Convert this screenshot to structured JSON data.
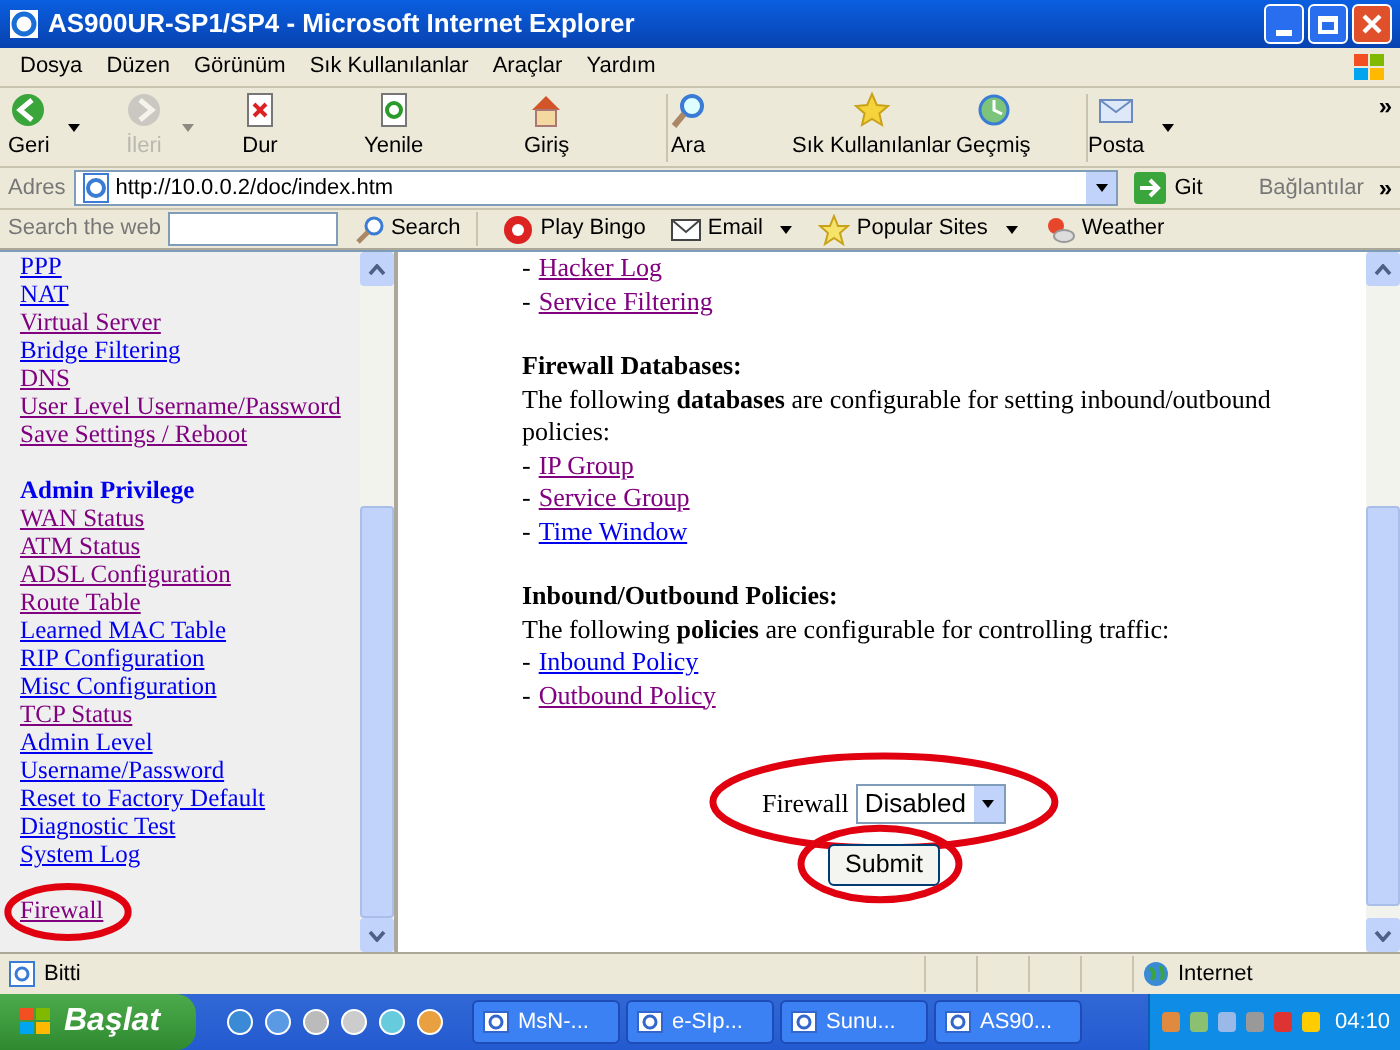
{
  "window": {
    "title": "AS900UR-SP1/SP4 - Microsoft Internet Explorer"
  },
  "menu": [
    "Dosya",
    "Düzen",
    "Görünüm",
    "Sık Kullanılanlar",
    "Araçlar",
    "Yardım"
  ],
  "toolbar": [
    {
      "label": "Geri",
      "disabled": false,
      "dropdown": true
    },
    {
      "label": "İleri",
      "disabled": true,
      "dropdown": true
    },
    {
      "label": "Dur",
      "disabled": false,
      "dropdown": false
    },
    {
      "label": "Yenile",
      "disabled": false,
      "dropdown": false
    },
    {
      "label": "Giriş",
      "disabled": false,
      "dropdown": false
    },
    {
      "label": "Ara",
      "disabled": false,
      "dropdown": false
    },
    {
      "label": "Sık Kullanılanlar",
      "disabled": false,
      "dropdown": false
    },
    {
      "label": "Geçmiş",
      "disabled": false,
      "dropdown": false
    },
    {
      "label": "Posta",
      "disabled": false,
      "dropdown": true
    }
  ],
  "toolbar_more": "»",
  "address": {
    "label": "Adres",
    "value": "http://10.0.0.2/doc/index.htm",
    "go": "Git",
    "links": "Bağlantılar",
    "more": "»"
  },
  "search_bar": {
    "label": "Search the web",
    "button": "Search",
    "items": [
      {
        "label": "Play Bingo",
        "dropdown": false
      },
      {
        "label": "Email",
        "dropdown": true
      },
      {
        "label": "Popular Sites",
        "dropdown": true
      },
      {
        "label": "Weather",
        "dropdown": false
      }
    ]
  },
  "sidebar": {
    "sections": [
      {
        "links": [
          {
            "label": "PPP",
            "visited": false,
            "circled": false
          },
          {
            "label": "NAT",
            "visited": false,
            "circled": false
          },
          {
            "label": "Virtual Server",
            "visited": true,
            "circled": false
          },
          {
            "label": "Bridge Filtering",
            "visited": false,
            "circled": false
          },
          {
            "label": "DNS",
            "visited": true,
            "circled": false
          },
          {
            "label": "User Level Username/Password",
            "visited": true,
            "circled": false
          },
          {
            "label": "Save Settings / Reboot",
            "visited": true,
            "circled": false
          }
        ]
      },
      {
        "heading": "Admin Privilege",
        "links": [
          {
            "label": "WAN Status",
            "visited": true,
            "circled": false
          },
          {
            "label": "ATM Status",
            "visited": true,
            "circled": false
          },
          {
            "label": "ADSL Configuration",
            "visited": true,
            "circled": false
          },
          {
            "label": "Route Table",
            "visited": true,
            "circled": false
          },
          {
            "label": "Learned MAC Table",
            "visited": false,
            "circled": false
          },
          {
            "label": "RIP Configuration",
            "visited": false,
            "circled": false
          },
          {
            "label": "Misc Configuration",
            "visited": false,
            "circled": false
          },
          {
            "label": "TCP Status",
            "visited": true,
            "circled": false
          },
          {
            "label": "Admin Level",
            "visited": false,
            "circled": false
          },
          {
            "label": "Username/Password",
            "visited": false,
            "circled": false
          },
          {
            "label": "Reset to Factory Default",
            "visited": false,
            "circled": false
          },
          {
            "label": "Diagnostic Test",
            "visited": false,
            "circled": false
          },
          {
            "label": "System Log",
            "visited": false,
            "circled": false
          }
        ]
      },
      {
        "links": [
          {
            "label": "Firewall",
            "visited": true,
            "circled": true
          }
        ]
      }
    ]
  },
  "content": {
    "sections": [
      {
        "links": [
          {
            "bullet": "-",
            "label": "Hacker Log",
            "visited": true
          },
          {
            "bullet": "-",
            "label": "Service Filtering",
            "visited": true
          }
        ]
      },
      {
        "heading": "Firewall Databases:",
        "text": "The following **databases** are configurable for setting inbound/outbound policies:",
        "links": [
          {
            "bullet": "-",
            "label": "IP Group",
            "visited": true
          },
          {
            "bullet": "-",
            "label": "Service Group",
            "visited": true
          },
          {
            "bullet": "-",
            "label": "Time Window",
            "visited": false
          }
        ]
      },
      {
        "heading": "Inbound/Outbound Policies:",
        "text": "The following **policies** are configurable for controlling traffic:",
        "links": [
          {
            "bullet": "-",
            "label": "Inbound Policy",
            "visited": false
          },
          {
            "bullet": "-",
            "label": "Outbound Policy",
            "visited": true
          }
        ]
      }
    ],
    "form": {
      "label": "Firewall",
      "value": "Disabled",
      "select_circled": true,
      "submit": "Submit",
      "submit_circled": true
    }
  },
  "status_bar": {
    "text": "Bitti",
    "zone": "Internet"
  },
  "taskbar": {
    "start": "Başlat",
    "tasks": [
      "MsN-...",
      "e-SIp...",
      "Sunu...",
      "AS90..."
    ],
    "clock": "04:10"
  }
}
